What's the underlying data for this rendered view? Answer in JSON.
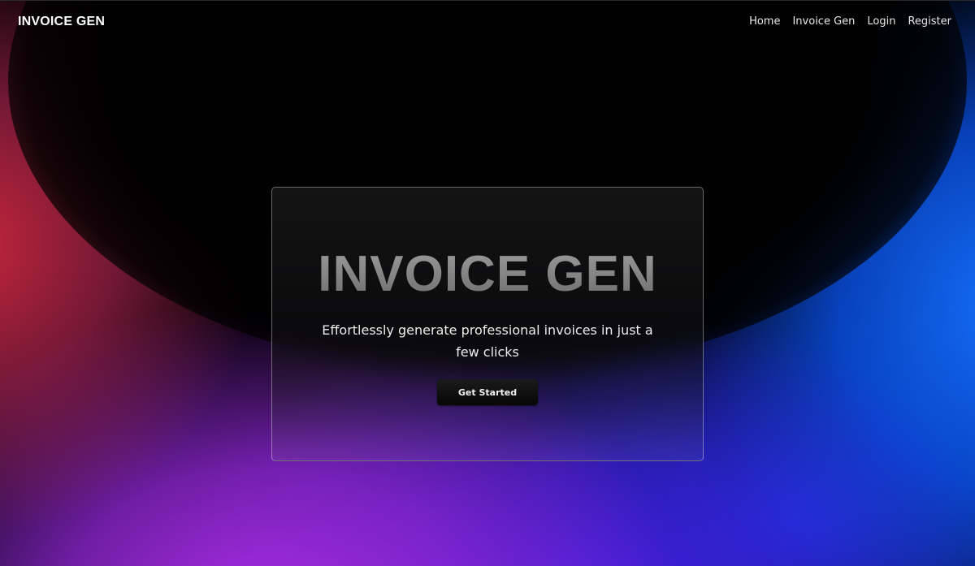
{
  "nav": {
    "logo": "INVOICE GEN",
    "links": [
      "Home",
      "Invoice Gen",
      "Login",
      "Register"
    ]
  },
  "hero": {
    "title": "INVOICE GEN",
    "subtitle": "Effortlessly generate professional invoices in just a few clicks",
    "cta_label": "Get Started"
  },
  "colors": {
    "background": "#000000",
    "accent_red": "#d2283c",
    "accent_purple": "#aa2de6",
    "accent_blue": "#146efa"
  }
}
